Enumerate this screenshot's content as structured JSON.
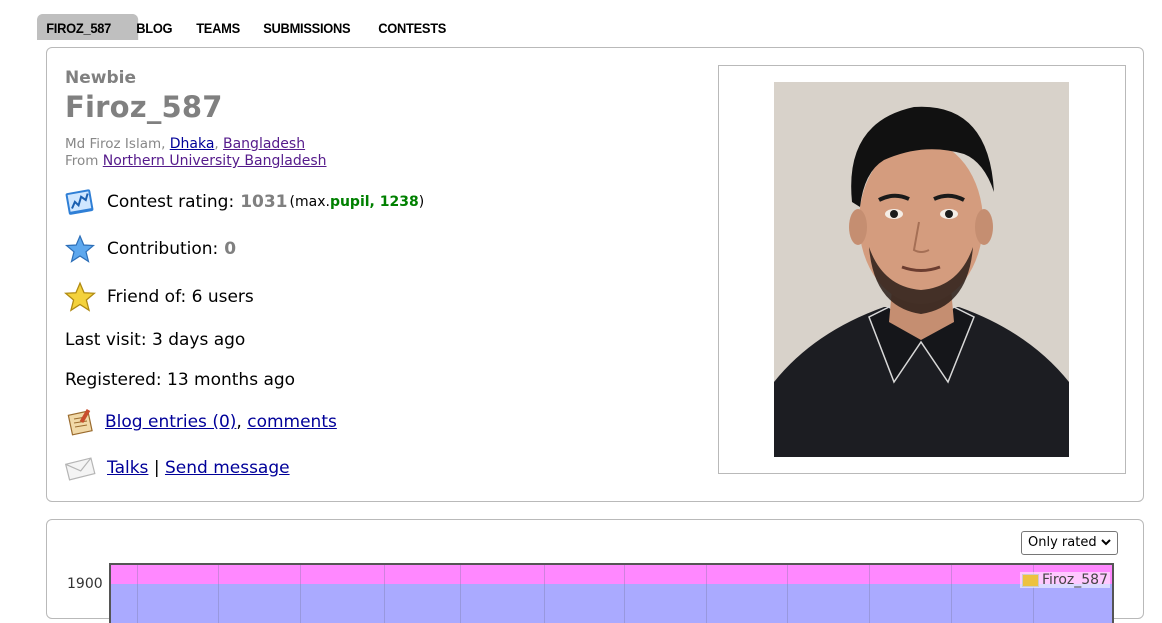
{
  "nav": {
    "items": [
      "FIROZ_587",
      "BLOG",
      "TEAMS",
      "SUBMISSIONS",
      "CONTESTS"
    ]
  },
  "profile": {
    "rank": "Newbie",
    "handle": "Firoz_587",
    "name_prefix": "Md Firoz Islam, ",
    "city": "Dhaka",
    "country": "Bangladesh",
    "from_prefix": "From ",
    "organization": "Northern University Bangladesh",
    "rating_label": "Contest rating: ",
    "rating_value": "1031",
    "max_open": " (max. ",
    "max_rank": "pupil, 1238",
    "max_close": ")",
    "contribution_label": "Contribution: ",
    "contribution_value": "0",
    "friend_label": "Friend of: 6 users",
    "last_visit": "Last visit: 3 days ago",
    "registered": "Registered: 13 months ago",
    "blog_link": "Blog entries (0)",
    "comma": ", ",
    "comments_link": "comments",
    "talks_link": "Talks",
    "separator": " | ",
    "send_message_link": "Send message",
    "icons": [
      "rating-graph-icon",
      "blue-star-icon",
      "gold-star-icon",
      "blog-notepad-icon",
      "envelope-icon"
    ]
  },
  "graph": {
    "select_value": "Only rated",
    "y_tick": "1900",
    "legend": "Firoz_587",
    "colors": {
      "pink_band": "#ff88ff",
      "purple_band": "#aaaaff",
      "legend_swatch": "#edc240"
    }
  }
}
